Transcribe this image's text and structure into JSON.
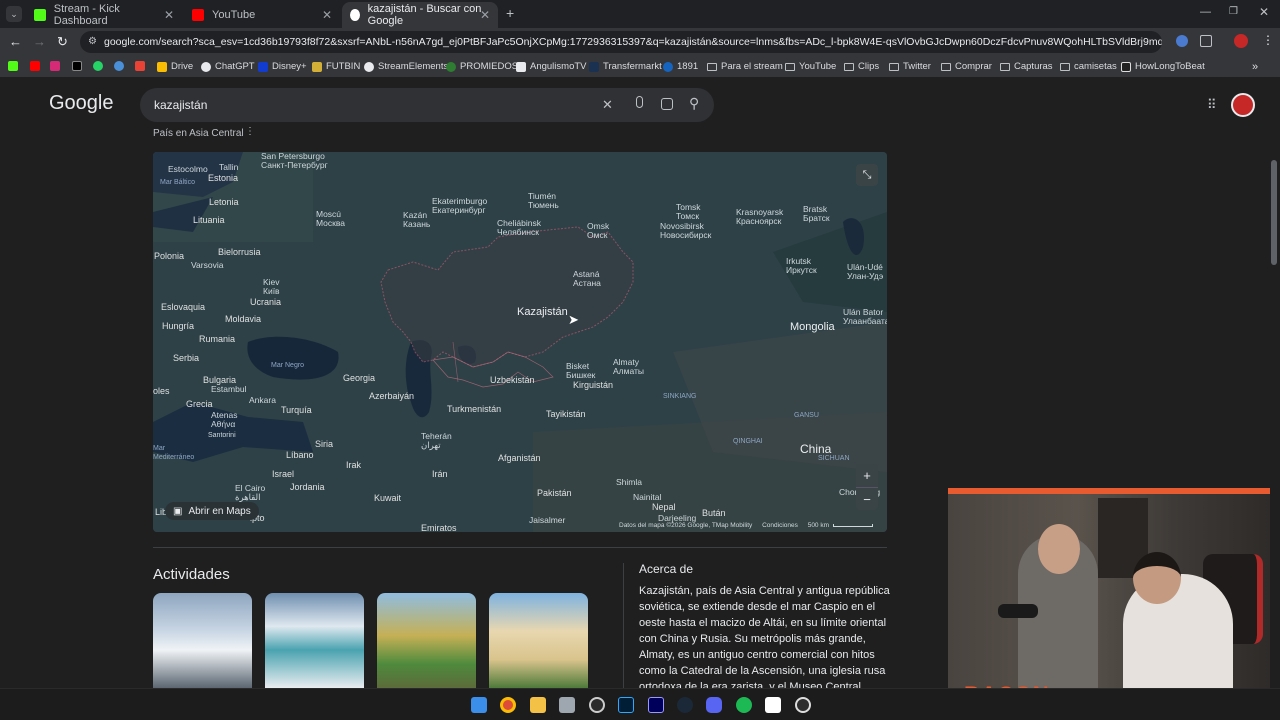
{
  "tabs": [
    {
      "label": "Stream - Kick Dashboard",
      "color": "#53fc18"
    },
    {
      "label": "YouTube",
      "color": "#ff0000"
    },
    {
      "label": "kazajistán - Buscar con Google",
      "color": "#4285f4"
    }
  ],
  "address_bar": {
    "url": "google.com/search?sca_esv=1cd36b19793f8f72&sxsrf=ANbL-n56nA7gd_ej0PtBFJaPc5OnjXCpMg:1772936315397&q=kazajistán&source=lnms&fbs=ADc_l-bpk8W4E-qsVlOvbGJcDwpn60DczFdcvPnuv8WQohHLTbSVldBrj9mdwFjfwIgEUgS3rVmfuCXE..."
  },
  "bookmarks": [
    "Drive",
    "ChatGPT",
    "Disney+",
    "FUTBIN",
    "StreamElements",
    "PROMIEDOS",
    "AngulismoTV",
    "Transfermarkt",
    "1891",
    "Para el stream",
    "YouTube",
    "Clips",
    "Twitter",
    "Comprar",
    "Capturas",
    "camisetas",
    "HowLongToBeat"
  ],
  "google": {
    "logo": "Google",
    "query": "kazajistán",
    "subtitle": "País en Asia Central"
  },
  "map": {
    "open_maps": "Abrir en Maps",
    "attribution": "Datos del mapa ©2026 Google, TMap Mobility",
    "conditions": "Condiciones",
    "scale": "500 km",
    "labels": [
      {
        "text": "Kazajistán",
        "cls": "big"
      },
      {
        "text": "Mongolia",
        "cls": "big"
      },
      {
        "text": "China",
        "cls": "big"
      },
      {
        "text": "Uzbekistán",
        "cls": "country"
      },
      {
        "text": "Kirguistán",
        "cls": "country"
      },
      {
        "text": "Tayikistán",
        "cls": "country"
      },
      {
        "text": "Turkmenistán",
        "cls": "country"
      },
      {
        "text": "Afganistán",
        "cls": "country"
      },
      {
        "text": "Pakistán",
        "cls": "country"
      },
      {
        "text": "Irán",
        "cls": "country"
      },
      {
        "text": "Irak",
        "cls": "country"
      },
      {
        "text": "Kuwait",
        "cls": "country"
      },
      {
        "text": "Jordania",
        "cls": "country"
      },
      {
        "text": "Israel",
        "cls": "country"
      },
      {
        "text": "Líbano",
        "cls": "country"
      },
      {
        "text": "Siria",
        "cls": "country"
      },
      {
        "text": "Turquía",
        "cls": "country"
      },
      {
        "text": "Georgia",
        "cls": "country"
      },
      {
        "text": "Azerbaiyán",
        "cls": "country"
      },
      {
        "text": "Grecia",
        "cls": "country"
      },
      {
        "text": "Bulgaria",
        "cls": "country"
      },
      {
        "text": "Serbia",
        "cls": "country"
      },
      {
        "text": "Rumania",
        "cls": "country"
      },
      {
        "text": "Hungría",
        "cls": "country"
      },
      {
        "text": "Eslovaquia",
        "cls": "country"
      },
      {
        "text": "Moldavia",
        "cls": "country"
      },
      {
        "text": "Ucrania",
        "cls": "country"
      },
      {
        "text": "Polonia",
        "cls": "country"
      },
      {
        "text": "Bielorrusia",
        "cls": "country"
      },
      {
        "text": "Lituania",
        "cls": "country"
      },
      {
        "text": "Letonia",
        "cls": "country"
      },
      {
        "text": "Estonia",
        "cls": "country"
      },
      {
        "text": "Nepal",
        "cls": "country"
      },
      {
        "text": "Bután",
        "cls": "country"
      },
      {
        "text": "Emiratos",
        "cls": "country"
      },
      {
        "text": "Mar Negro",
        "cls": "sea"
      },
      {
        "text": "Mar Báltico",
        "cls": "sea"
      },
      {
        "text": "Mar Mediterráneo",
        "cls": "sea"
      },
      {
        "text": "Astaná\nАстана",
        "cls": "city"
      },
      {
        "text": "Almaty\nАлматы",
        "cls": "city"
      },
      {
        "text": "Bisket\nБишкек",
        "cls": "city"
      },
      {
        "text": "Omsk\nОмск",
        "cls": "city"
      },
      {
        "text": "Tiumén\nТюмень",
        "cls": "city"
      },
      {
        "text": "Ekaterimburgo\nЕкатеринбург",
        "cls": "city"
      },
      {
        "text": "Cheliábinsk\nЧелябинск",
        "cls": "city"
      },
      {
        "text": "Novosibirsk\nНовосибирск",
        "cls": "city"
      },
      {
        "text": "Tomsk\nТомск",
        "cls": "city"
      },
      {
        "text": "Krasnoyarsk\nКрасноярск",
        "cls": "city"
      },
      {
        "text": "Bratsk\nБратск",
        "cls": "city"
      },
      {
        "text": "Irkutsk\nИркутск",
        "cls": "city"
      },
      {
        "text": "Ulán-Udé\nУлан-Удэ",
        "cls": "city"
      },
      {
        "text": "Ulán Bator\nУлаанбаатар",
        "cls": "city"
      },
      {
        "text": "Kazán\nКазань",
        "cls": "city"
      },
      {
        "text": "Moscú\nМосква",
        "cls": "city"
      },
      {
        "text": "San Petersburgo\nСанкт-Петербург",
        "cls": "city"
      },
      {
        "text": "Tallin",
        "cls": "city"
      },
      {
        "text": "Estocolmo",
        "cls": "city"
      },
      {
        "text": "Varsovia",
        "cls": "city"
      },
      {
        "text": "Kiev\nКиїв",
        "cls": "city"
      },
      {
        "text": "Estambul",
        "cls": "city"
      },
      {
        "text": "Ankara",
        "cls": "city"
      },
      {
        "text": "Atenas\nΑθήνα",
        "cls": "city"
      },
      {
        "text": "Santorini",
        "cls": "city"
      },
      {
        "text": "Teherán\nتهران",
        "cls": "city"
      },
      {
        "text": "El Cairo\nالقاهرة",
        "cls": "city"
      },
      {
        "text": "Shimla",
        "cls": "city"
      },
      {
        "text": "Nainital",
        "cls": "city"
      },
      {
        "text": "Darjeeling",
        "cls": "city"
      },
      {
        "text": "Jaisalmer",
        "cls": "city"
      },
      {
        "text": "Chongqing",
        "cls": "city"
      },
      {
        "text": "Lib",
        "cls": "country"
      },
      {
        "text": "ipto",
        "cls": "country"
      },
      {
        "text": "oles",
        "cls": "country"
      },
      {
        "text": "SINKIANG",
        "cls": "sea"
      },
      {
        "text": "GANSU",
        "cls": "sea"
      },
      {
        "text": "QINGHAI",
        "cls": "sea"
      },
      {
        "text": "SICHUAN",
        "cls": "sea"
      }
    ]
  },
  "actividades": {
    "title": "Actividades"
  },
  "acerca": {
    "title": "Acerca de",
    "text": "Kazajistán, país de Asia Central y antigua república soviética, se extiende desde el mar Caspio en el oeste hasta el macizo de Altái, en su límite oriental con China y Rusia. Su metrópolis más grande, Almaty, es un antiguo centro comercial con hitos como la Catedral de la Ascensión, una iglesia rusa ortodoxa de la era zarista, y el Museo Central"
  },
  "webcam": {
    "overlay_text": "BACON"
  },
  "colors": {
    "map_bg": "#2c3e46",
    "border_pink": "#d9627a",
    "cam_accent": "#e85a30"
  }
}
